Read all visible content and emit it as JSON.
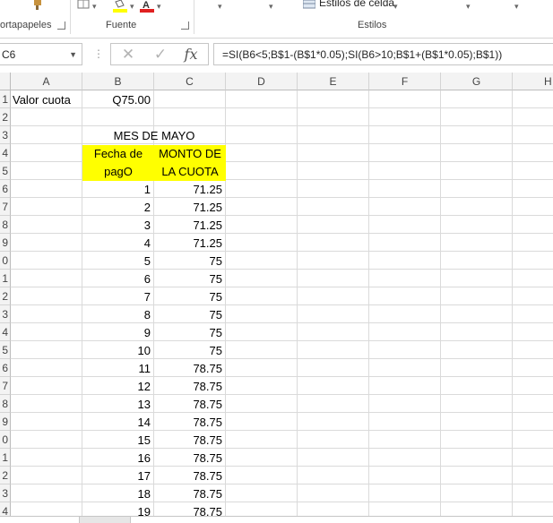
{
  "ribbon": {
    "clipboard_label": "ortapapeles",
    "font_label": "Fuente",
    "styles_label": "Estilos",
    "cell_styles_label": "Estilos de celda"
  },
  "formula_bar": {
    "name_box": "C6",
    "formula": "=SI(B6<5;B$1-(B$1*0.05);SI(B6>10;B$1+(B$1*0.05);B$1))",
    "fx_label": "fx"
  },
  "columns": [
    "A",
    "B",
    "C",
    "D",
    "E",
    "F",
    "G",
    "H"
  ],
  "rows": [
    "1",
    "2",
    "3",
    "4",
    "5",
    "6",
    "7",
    "8",
    "9",
    "0",
    "1",
    "2",
    "3",
    "4",
    "5",
    "6",
    "7",
    "8",
    "9",
    "0",
    "1",
    "2",
    "3",
    "4"
  ],
  "sheet": {
    "a1": "Valor cuota",
    "b1": "Q75.00",
    "b3": "MES DE MAYO",
    "b4": "Fecha de",
    "b5": "pagO",
    "c4": "MONTO DE",
    "c5": "LA CUOTA",
    "data": [
      {
        "day": "1",
        "amount": "71.25"
      },
      {
        "day": "2",
        "amount": "71.25"
      },
      {
        "day": "3",
        "amount": "71.25"
      },
      {
        "day": "4",
        "amount": "71.25"
      },
      {
        "day": "5",
        "amount": "75"
      },
      {
        "day": "6",
        "amount": "75"
      },
      {
        "day": "7",
        "amount": "75"
      },
      {
        "day": "8",
        "amount": "75"
      },
      {
        "day": "9",
        "amount": "75"
      },
      {
        "day": "10",
        "amount": "75"
      },
      {
        "day": "11",
        "amount": "78.75"
      },
      {
        "day": "12",
        "amount": "78.75"
      },
      {
        "day": "13",
        "amount": "78.75"
      },
      {
        "day": "14",
        "amount": "78.75"
      },
      {
        "day": "15",
        "amount": "78.75"
      },
      {
        "day": "16",
        "amount": "78.75"
      },
      {
        "day": "17",
        "amount": "78.75"
      },
      {
        "day": "18",
        "amount": "78.75"
      },
      {
        "day": "19",
        "amount": "78.75"
      }
    ]
  },
  "colors": {
    "header_highlight": "#ffff00",
    "grid_line": "#dadada",
    "header_bg": "#f3f3f3"
  }
}
